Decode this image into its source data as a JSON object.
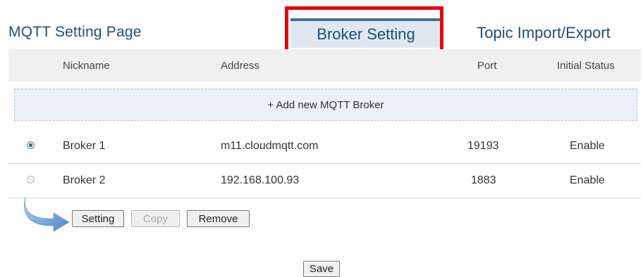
{
  "page": {
    "title": "MQTT Setting Page"
  },
  "tabs": [
    {
      "label": "Broker Setting",
      "active": true
    },
    {
      "label": "Topic Import/Export",
      "active": false
    }
  ],
  "table": {
    "columns": [
      "Nickname",
      "Address",
      "Port",
      "Initial Status"
    ],
    "add_label": "+ Add new MQTT Broker",
    "rows": [
      {
        "selected": true,
        "nickname": "Broker 1",
        "address": "m11.cloudmqtt.com",
        "port": "19193",
        "status": "Enable"
      },
      {
        "selected": false,
        "nickname": "Broker 2",
        "address": "192.168.100.93",
        "port": "1883",
        "status": "Enable"
      }
    ]
  },
  "actions": {
    "setting_label": "Setting",
    "copy_label": "Copy",
    "remove_label": "Remove",
    "save_label": "Save"
  },
  "colors": {
    "title": "#1f4e79",
    "active_tab_bg": "#dfe8f1",
    "highlight": "#e30613",
    "add_row_bg": "#ebf1f7"
  }
}
